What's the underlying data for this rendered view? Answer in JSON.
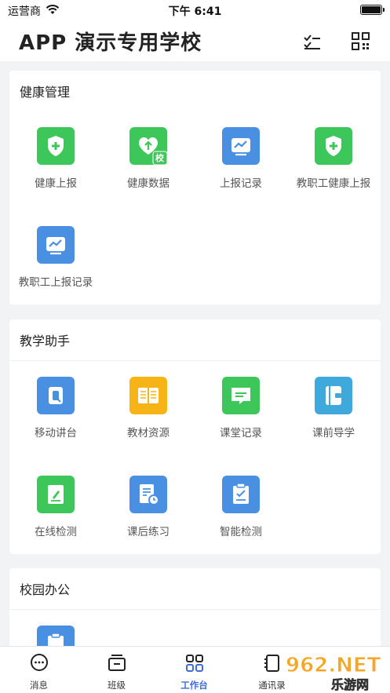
{
  "status": {
    "carrier": "运营商",
    "time": "下午 6:41"
  },
  "header": {
    "title": "APP 演示专用学校"
  },
  "sections": [
    {
      "title": "健康管理",
      "items": [
        {
          "label": "健康上报"
        },
        {
          "label": "健康数据",
          "badge": "校"
        },
        {
          "label": "上报记录"
        },
        {
          "label": "教职工健康上报"
        },
        {
          "label": "教职工上报记录"
        }
      ]
    },
    {
      "title": "教学助手",
      "items": [
        {
          "label": "移动讲台"
        },
        {
          "label": "教材资源"
        },
        {
          "label": "课堂记录"
        },
        {
          "label": "课前导学"
        },
        {
          "label": "在线检测"
        },
        {
          "label": "课后练习"
        },
        {
          "label": "智能检测"
        }
      ]
    },
    {
      "title": "校园办公",
      "items": []
    }
  ],
  "tabs": [
    {
      "label": "消息"
    },
    {
      "label": "班级"
    },
    {
      "label": "工作台"
    },
    {
      "label": "通讯录"
    }
  ],
  "watermark": {
    "brand": "962.NET",
    "sub": "乐游网"
  },
  "colors": {
    "green": "#3dc75a",
    "blue": "#4a90e2",
    "orange": "#f7b416",
    "teal": "#40a9dc",
    "tab_active": "#3f6bd8"
  }
}
